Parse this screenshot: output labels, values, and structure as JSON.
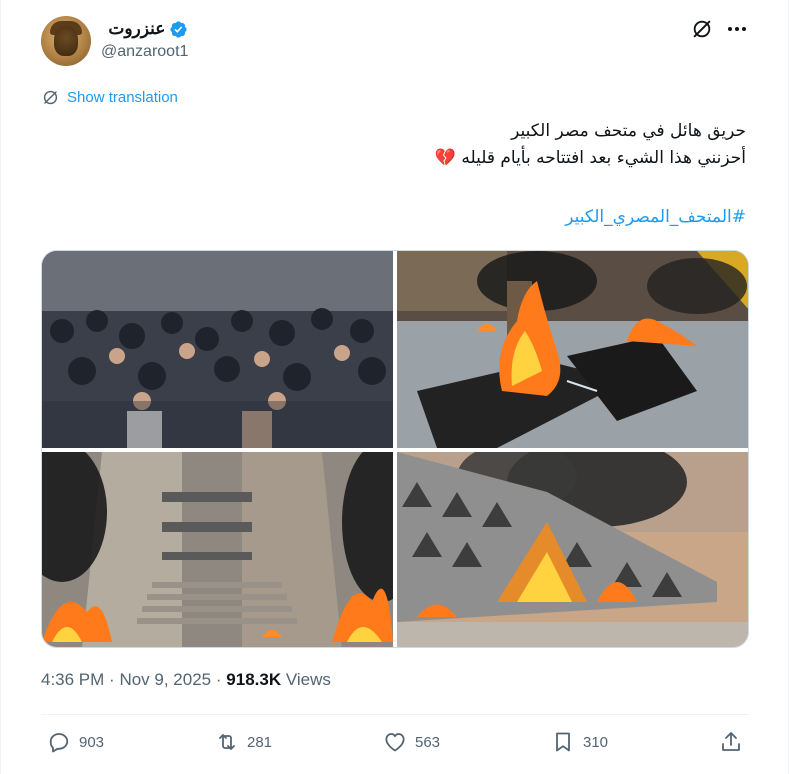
{
  "author": {
    "display_name": "عنزروت",
    "handle": "@anzaroot1",
    "verified": true
  },
  "translate_label": "Show translation",
  "tweet": {
    "lines": [
      "حريق هائل في متحف مصر الكبير",
      "أحزنني هذا الشيء بعد افتتاحه بأيام قليله 💔"
    ],
    "hashtag": "#المتحف_المصري_الكبير"
  },
  "media": [
    "crowd-photo",
    "fire-interior-statue-photo",
    "fire-staircase-photo",
    "fire-facade-photo"
  ],
  "meta": {
    "time": "4:36 PM",
    "separator": "·",
    "date": "Nov 9, 2025",
    "views_count": "918.3K",
    "views_label": "Views"
  },
  "actions": {
    "replies": "903",
    "reposts": "281",
    "likes": "563",
    "bookmarks": "310"
  },
  "colors": {
    "accent": "#1d9bf0",
    "secondary_text": "#536471",
    "fire": "#ff7a1a"
  }
}
